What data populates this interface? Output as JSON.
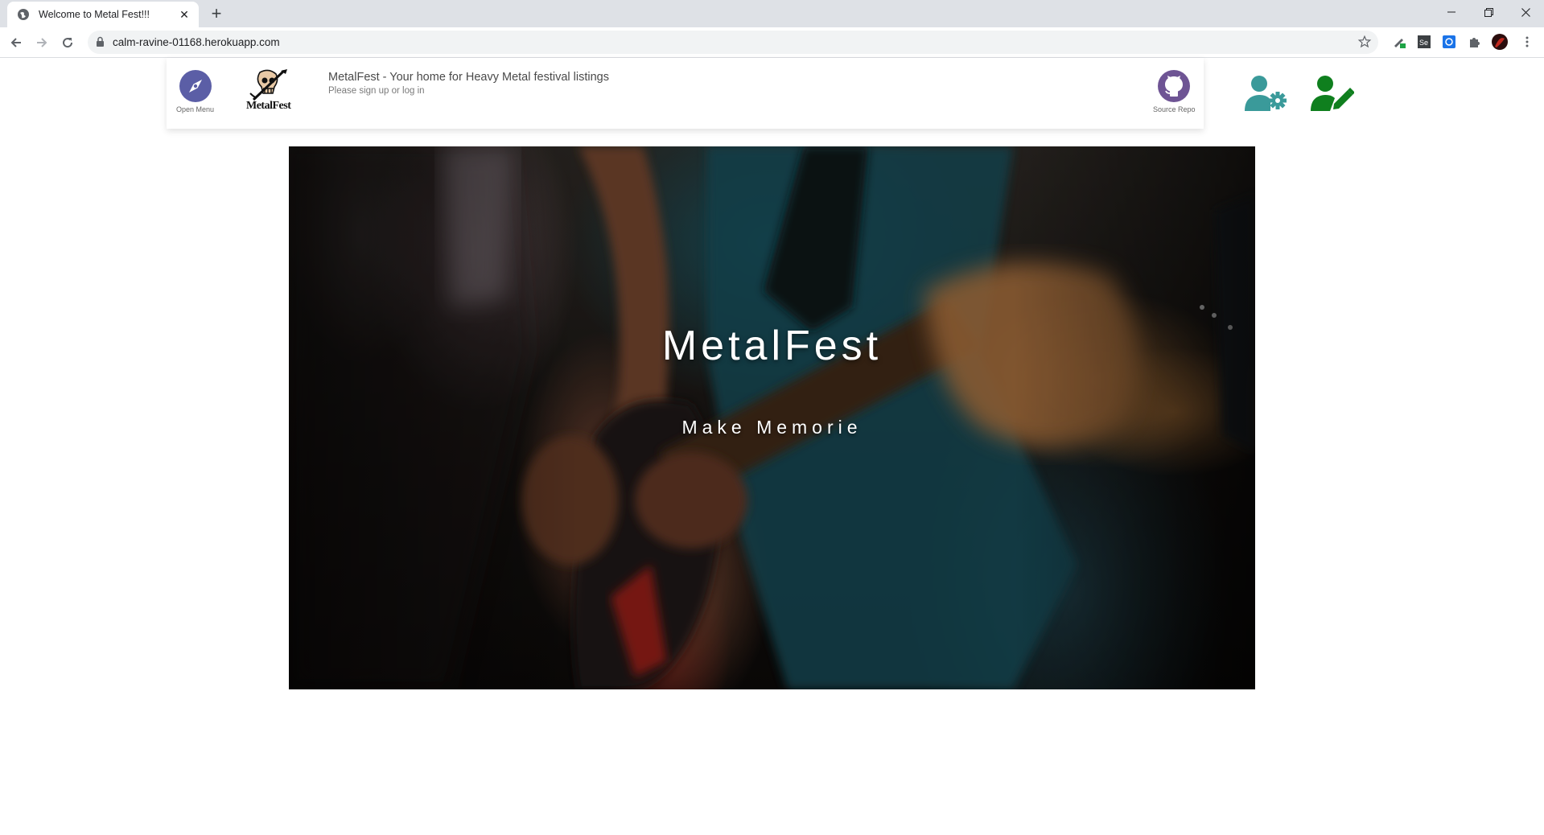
{
  "browser": {
    "tab_title": "Welcome to Metal Fest!!!",
    "url": "calm-ravine-01168.herokuapp.com"
  },
  "navbar": {
    "open_menu_label": "Open Menu",
    "logo_text": "MetalFest",
    "title": "MetalFest - Your home for Heavy Metal festival listings",
    "subtitle": "Please sign up or log in",
    "source_repo_label": "Source Repo"
  },
  "colors": {
    "menu_icon": "#5b5ea6",
    "github_icon": "#6e5494",
    "user_settings_icon": "#3a9a9a",
    "user_edit_icon": "#0f7f1e"
  },
  "hero": {
    "title": "MetalFest",
    "subtitle": "Make Memorie"
  }
}
